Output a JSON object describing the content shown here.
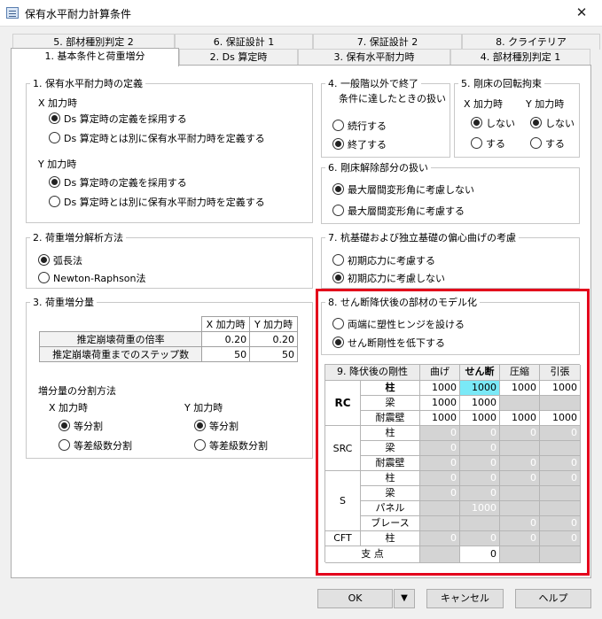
{
  "window": {
    "title": "保有水平耐力計算条件"
  },
  "tabs_back": [
    "5. 部材種別判定 2",
    "6. 保証設計 1",
    "7. 保証設計 2",
    "8. クライテリア"
  ],
  "tabs_front": [
    "1. 基本条件と荷重増分",
    "2. Ds 算定時",
    "3. 保有水平耐力時",
    "4. 部材種別判定 1"
  ],
  "g1": {
    "title": "1. 保有水平耐力時の定義",
    "x_label": "X 加力時",
    "x_opt1": "Ds 算定時の定義を採用する",
    "x_opt2": "Ds 算定時とは別に保有水平耐力時を定義する",
    "y_label": "Y 加力時",
    "y_opt1": "Ds 算定時の定義を採用する",
    "y_opt2": "Ds 算定時とは別に保有水平耐力時を定義する"
  },
  "g2": {
    "title": "2. 荷重増分解析方法",
    "opt1": "弧長法",
    "opt2": "Newton-Raphson法"
  },
  "g3": {
    "title": "3. 荷重増分量",
    "col_x": "X 加力時",
    "col_y": "Y 加力時",
    "row1": "推定崩壊荷重の倍率",
    "row1_x": "0.20",
    "row1_y": "0.20",
    "row2": "推定崩壊荷重までのステップ数",
    "row2_x": "50",
    "row2_y": "50",
    "split_title": "増分量の分割方法",
    "x_label": "X 加力時",
    "y_label": "Y 加力時",
    "opt_equal": "等分割",
    "opt_diff": "等差級数分割"
  },
  "g4": {
    "title_l1": "4. 一般階以外で終了",
    "title_l2": "条件に達したときの扱い",
    "opt1": "続行する",
    "opt2": "終了する"
  },
  "g5": {
    "title": "5. 剛床の回転拘束",
    "x_label": "X 加力時",
    "y_label": "Y 加力時",
    "opt_no": "しない",
    "opt_yes": "する"
  },
  "g6": {
    "title": "6. 剛床解除部分の扱い",
    "opt1": "最大層間変形角に考慮しない",
    "opt2": "最大層間変形角に考慮する"
  },
  "g7": {
    "title": "7. 杭基礎および独立基礎の偏心曲げの考慮",
    "opt1": "初期応力に考慮する",
    "opt2": "初期応力に考慮しない"
  },
  "g8": {
    "title": "8. せん断降伏後の部材のモデル化",
    "opt1": "両端に塑性ヒンジを設ける",
    "opt2": "せん断剛性を低下する"
  },
  "g9": {
    "title": "9. 降伏後の剛性",
    "cols": [
      "曲げ",
      "せん断",
      "圧縮",
      "引張"
    ],
    "groups": {
      "rc": "RC",
      "src": "SRC",
      "s": "S",
      "cft": "CFT",
      "support": "支 点"
    },
    "rc_col": "柱",
    "rc_beam": "梁",
    "rc_wall": "耐震壁",
    "src_col": "柱",
    "src_beam": "梁",
    "src_wall": "耐震壁",
    "s_col": "柱",
    "s_beam": "梁",
    "s_panel": "パネル",
    "s_brace": "ブレース",
    "cft_col": "柱",
    "v1000": "1000",
    "v0": "0"
  },
  "buttons": {
    "ok": "OK",
    "cancel": "キャンセル",
    "help": "ヘルプ"
  },
  "colors": {
    "highlight": "#7ae9f7",
    "red_box": "#e3001b"
  }
}
